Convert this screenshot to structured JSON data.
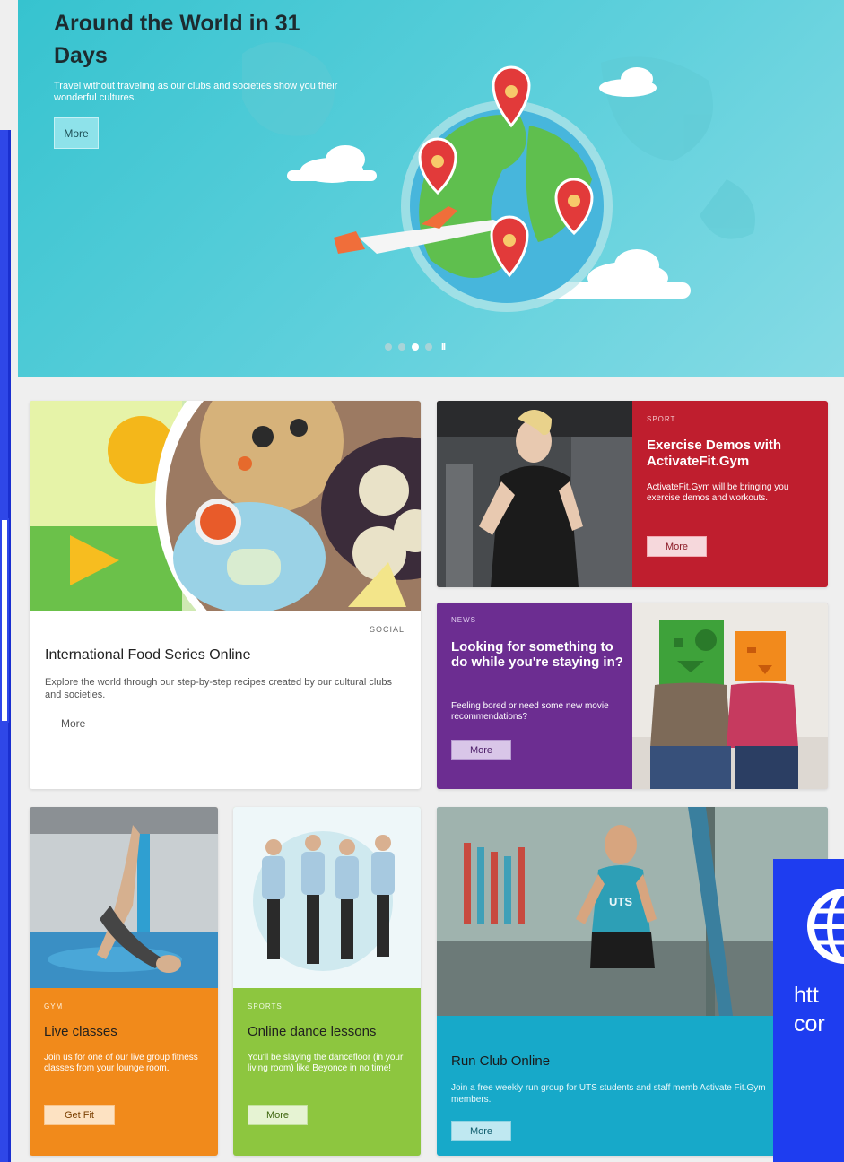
{
  "hero": {
    "title": "Around the World in 31 Days",
    "description": "Travel without traveling as our clubs and societies show you their wonderful cultures.",
    "button_label": "More",
    "pause_label": "II"
  },
  "cards": {
    "food": {
      "category": "SOCIAL",
      "title": "International Food Series Online",
      "description": "Explore the world through our step-by-step recipes created by our cultural clubs and societies.",
      "button_label": "More"
    },
    "exercise": {
      "category": "SPORT",
      "title": "Exercise Demos with ActivateFit.Gym",
      "description": "ActivateFit.Gym will be bringing you exercise demos and workouts.",
      "button_label": "More"
    },
    "looking": {
      "category": "NEWS",
      "title": "Looking for something to do while you're staying in?",
      "description": "Feeling bored or need some new movie recommendations?",
      "button_label": "More"
    },
    "live": {
      "category": "GYM",
      "title": "Live classes",
      "description": "Join us for one of our live group fitness classes from your lounge room.",
      "button_label": "Get Fit"
    },
    "dance": {
      "category": "SPORTS",
      "title": "Online dance lessons",
      "description": "You'll be slaying the dancefloor (in your living room) like Beyonce in no time!",
      "button_label": "More"
    },
    "run": {
      "category": "",
      "title": "Run Club Online",
      "description": "Join a free weekly run group for UTS students and staff memb Activate Fit.Gym members.",
      "button_label": "More",
      "shirt_text": "UTS"
    }
  },
  "overlay": {
    "line1": "htt",
    "line2": "cor",
    "icon": "globe-icon"
  },
  "colors": {
    "hero_bg": "#4fcbd6",
    "sport_red": "#bf1e2e",
    "news_purple": "#6c2d91",
    "gym_orange": "#f18a1b",
    "sports_green": "#8dc63f",
    "run_blue": "#17a9c9",
    "overlay_blue": "#1e3df0"
  }
}
